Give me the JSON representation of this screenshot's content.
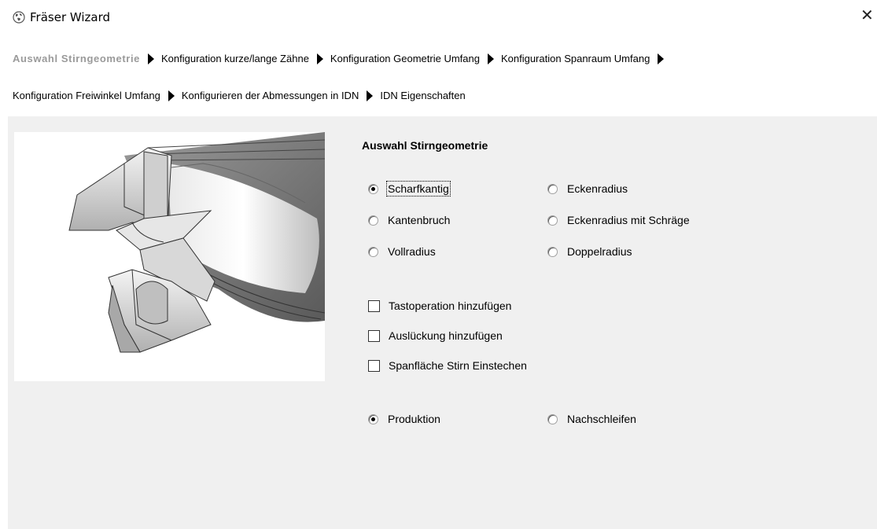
{
  "window": {
    "title": "Fräser Wizard",
    "app_icon": "globe-icon",
    "close_glyph": "✕"
  },
  "breadcrumbs": {
    "row1": [
      "Auswahl Stirngeometrie",
      "Konfiguration kurze/lange Zähne",
      "Konfiguration Geometrie Umfang",
      "Konfiguration Spanraum Umfang"
    ],
    "row2": [
      "Konfiguration Freiwinkel Umfang",
      "Konfigurieren der Abmessungen in IDN",
      "IDN Eigenschaften"
    ],
    "active_index": 0
  },
  "section": {
    "title": "Auswahl Stirngeometrie"
  },
  "geometry_options": [
    {
      "label": "Scharfkantig",
      "checked": true
    },
    {
      "label": "Eckenradius",
      "checked": false
    },
    {
      "label": "Kantenbruch",
      "checked": false
    },
    {
      "label": "Eckenradius mit Schräge",
      "checked": false
    },
    {
      "label": "Vollradius",
      "checked": false
    },
    {
      "label": "Doppelradius",
      "checked": false
    }
  ],
  "checkboxes": [
    {
      "label": "Tastoperation hinzufügen",
      "checked": false
    },
    {
      "label": "Auslückung hinzufügen",
      "checked": false
    },
    {
      "label": "Spanfläche Stirn Einstechen",
      "checked": false
    }
  ],
  "mode_options": [
    {
      "label": "Produktion",
      "checked": true
    },
    {
      "label": "Nachschleifen",
      "checked": false
    }
  ],
  "colors": {
    "panel_bg": "#f0f0f0",
    "inactive_crumb": "#9a9a9a"
  }
}
